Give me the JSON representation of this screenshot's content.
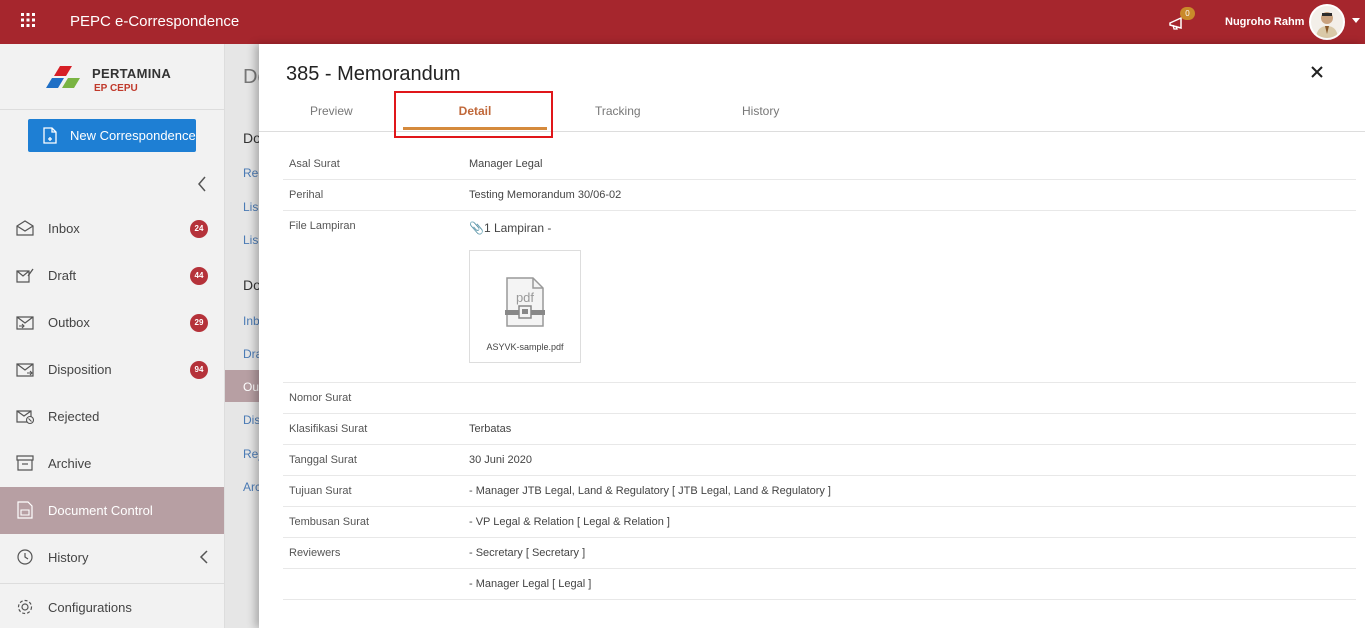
{
  "topbar": {
    "app_title": "PEPC e-Correspondence",
    "notification_count": "0",
    "user_name": "Nugroho Rahm"
  },
  "sidebar": {
    "logo_name": "PERTAMINA",
    "logo_sub": "EP CEPU",
    "new_button": "New Correspondence",
    "items": [
      {
        "label": "Inbox",
        "badge": "24",
        "icon": "inbox-icon"
      },
      {
        "label": "Draft",
        "badge": "44",
        "icon": "draft-icon"
      },
      {
        "label": "Outbox",
        "badge": "29",
        "icon": "outbox-icon"
      },
      {
        "label": "Disposition",
        "badge": "94",
        "icon": "disposition-icon"
      },
      {
        "label": "Rejected",
        "badge": "",
        "icon": "rejected-icon"
      },
      {
        "label": "Archive",
        "badge": "",
        "icon": "archive-icon"
      },
      {
        "label": "Document Control",
        "badge": "",
        "icon": "document-control-icon",
        "active": true
      },
      {
        "label": "History",
        "badge": "",
        "icon": "history-icon"
      },
      {
        "label": "Configurations",
        "badge": "",
        "icon": "gear-icon"
      }
    ]
  },
  "background": {
    "title": "Do",
    "sections": [
      "Do",
      "Rec",
      "Lis",
      "Lis",
      "Do",
      "Inb",
      "Dra",
      "Ou",
      "Dis",
      "Rej",
      "Arc"
    ]
  },
  "panel": {
    "title": "385 - Memorandum",
    "tabs": [
      "Preview",
      "Detail",
      "Tracking",
      "History"
    ],
    "fields": {
      "asal_surat_label": "Asal Surat",
      "asal_surat_value": "Manager Legal",
      "perihal_label": "Perihal",
      "perihal_value": "Testing Memorandum 30/06-02",
      "file_label": "File Lampiran",
      "file_value": "1 Lampiran -",
      "file_name": "ASYVK-sample.pdf",
      "nomor_label": "Nomor Surat",
      "nomor_value": "",
      "klasifikasi_label": "Klasifikasi Surat",
      "klasifikasi_value": "Terbatas",
      "tanggal_label": "Tanggal Surat",
      "tanggal_value": "30 Juni 2020",
      "tujuan_label": "Tujuan Surat",
      "tujuan_value": "- Manager JTB Legal, Land & Regulatory [ JTB Legal, Land & Regulatory ]",
      "tembusan_label": "Tembusan Surat",
      "tembusan_value": "- VP Legal & Relation [ Legal & Relation ]",
      "reviewers_label": "Reviewers",
      "reviewers": [
        "- Secretary [ Secretary ]",
        "- Manager Legal [ Legal ]"
      ]
    }
  },
  "colors": {
    "topbar": "#a6262d",
    "primary_button": "#1e7fd4",
    "badge": "#b5323a",
    "active_nav": "#b79fa3",
    "active_tab": "#d58a3c",
    "highlight": "#e0161a"
  }
}
